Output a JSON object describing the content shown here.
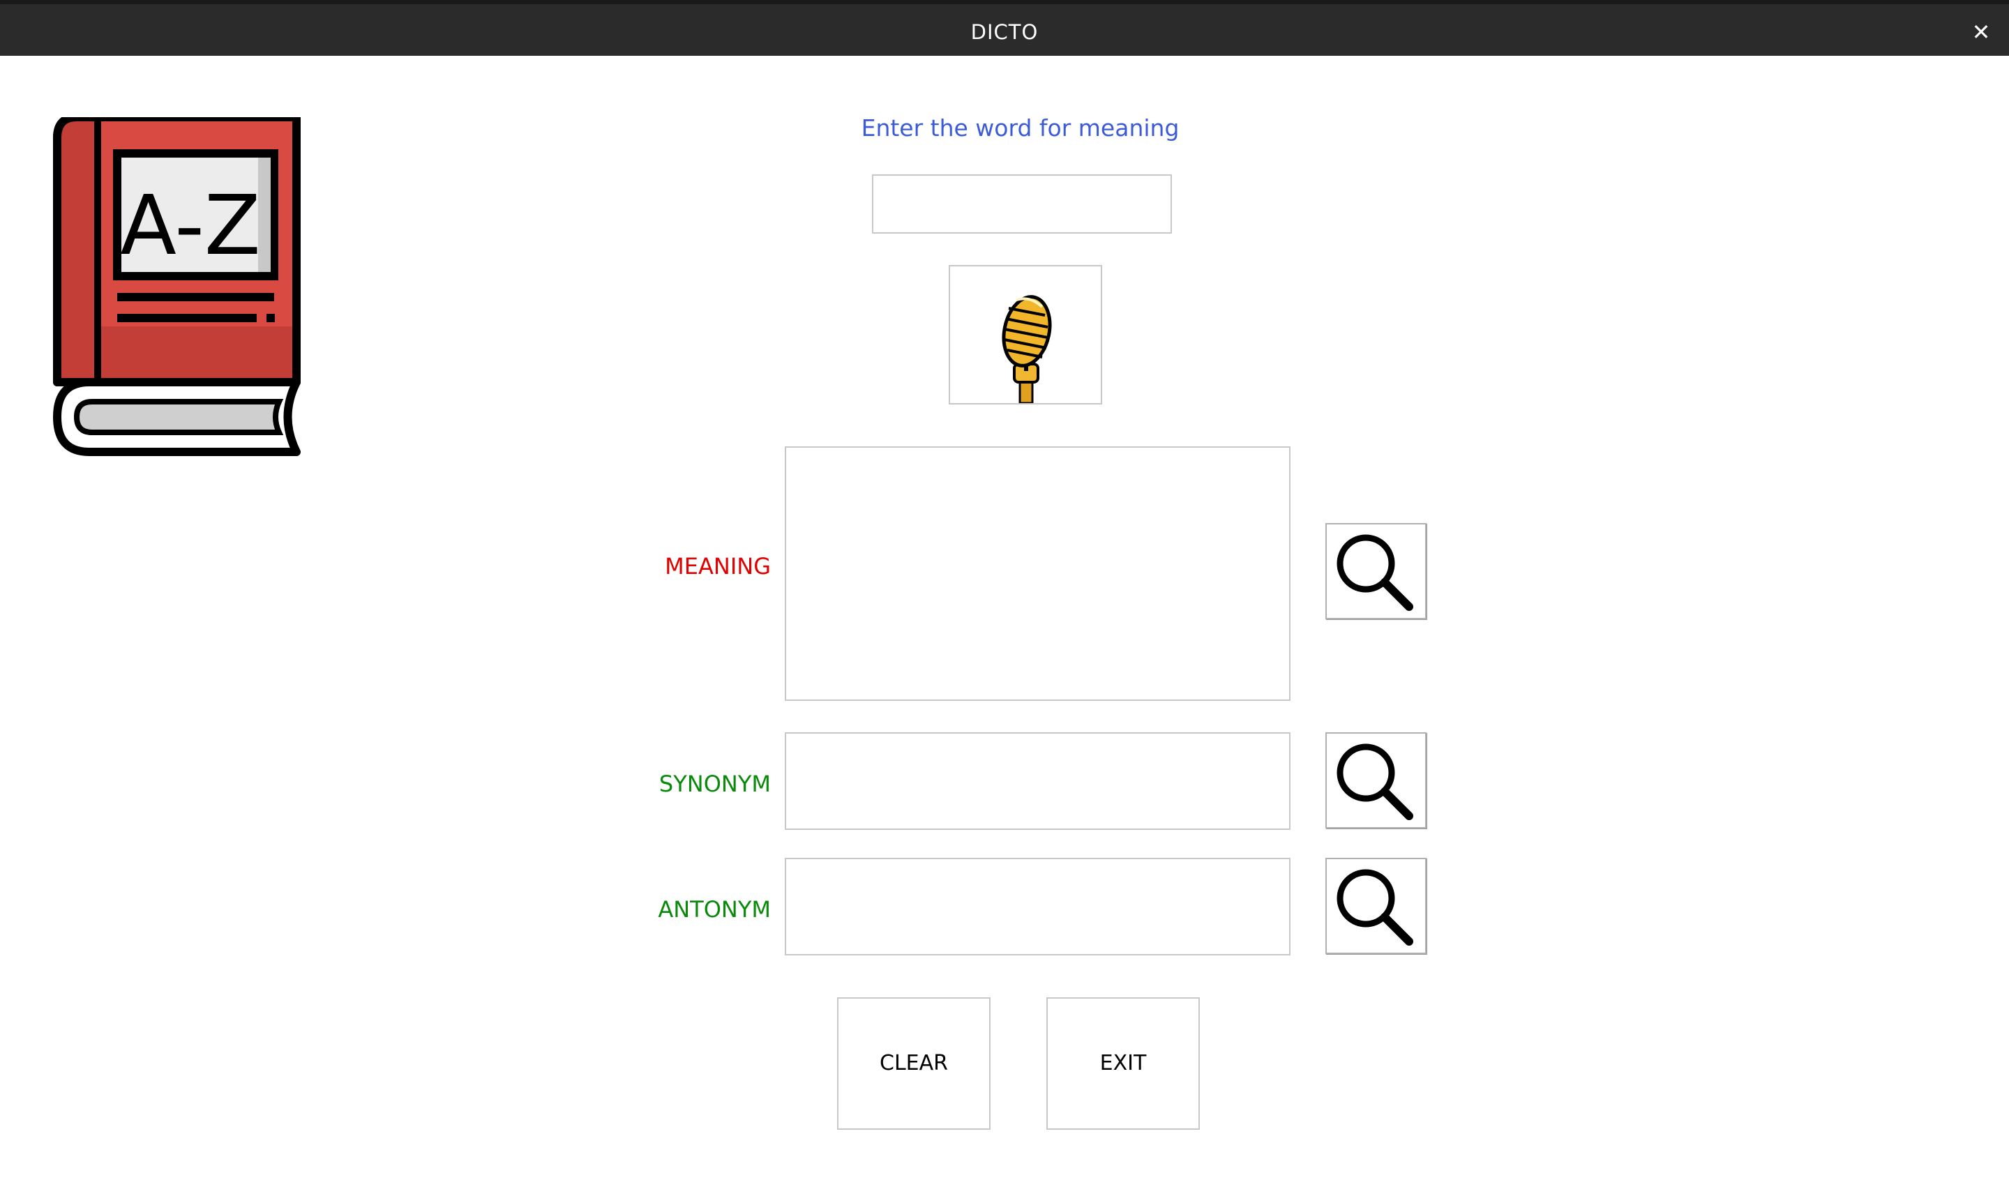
{
  "window": {
    "title": "DICTO",
    "close_symbol": "✕"
  },
  "logo": {
    "icon": "dictionary-book-icon",
    "text": "A-Z",
    "color": "#d94a42"
  },
  "prompt": {
    "text": "Enter the word for meaning",
    "color": "#3b5bdb"
  },
  "word_input": {
    "value": "",
    "placeholder": ""
  },
  "mic_button": {
    "icon": "microphone-icon"
  },
  "fields": {
    "meaning": {
      "label": "MEANING",
      "color": "#e00000",
      "value": ""
    },
    "synonym": {
      "label": "SYNONYM",
      "color": "#0a8a0a",
      "value": ""
    },
    "antonym": {
      "label": "ANTONYM",
      "color": "#0a8a0a",
      "value": ""
    }
  },
  "search_icon": "search-icon",
  "buttons": {
    "clear": "CLEAR",
    "exit": "EXIT"
  }
}
